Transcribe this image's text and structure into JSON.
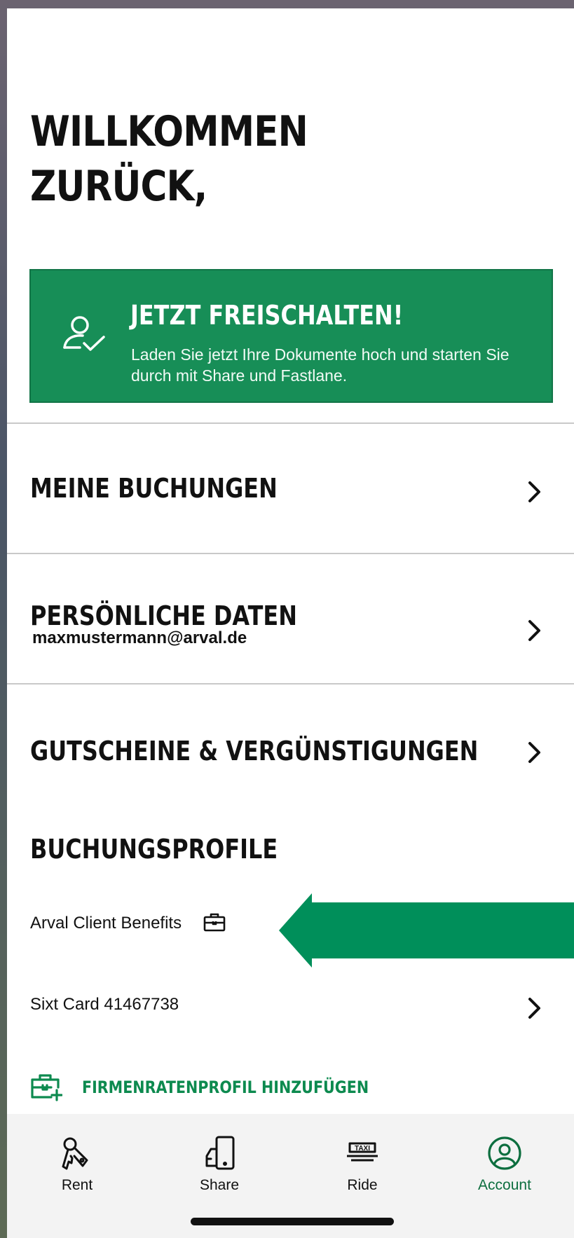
{
  "header": {
    "title_line1": "WILLKOMMEN",
    "title_line2": "ZURÜCK,"
  },
  "promo": {
    "icon": "user-check-icon",
    "title": "JETZT FREISCHALTEN!",
    "text": "Laden Sie jetzt Ihre Dokumente hoch und starten Sie durch mit Share und Fastlane."
  },
  "menu": {
    "bookings": "MEINE BUCHUNGEN",
    "personal": "PERSÖNLICHE DATEN",
    "email": "maxmustermann@arval.de",
    "vouchers": "GUTSCHEINE & VERGÜNSTIGUNGEN"
  },
  "profiles": {
    "heading": "BUCHUNGSPROFILE",
    "items": [
      {
        "label": "Arval Client Benefits",
        "icon": "briefcase-icon"
      },
      {
        "label": "Sixt Card 41467738"
      }
    ],
    "add_label": "FIRMENRATENPROFIL HINZUFÜGEN"
  },
  "tabs": [
    {
      "label": "Rent",
      "icon": "keys-icon"
    },
    {
      "label": "Share",
      "icon": "phone-car-icon"
    },
    {
      "label": "Ride",
      "icon": "taxi-icon"
    },
    {
      "label": "Account",
      "icon": "account-icon",
      "active": true
    }
  ],
  "colors": {
    "accent": "#178e57",
    "arrow": "#008f5a",
    "active_tab": "#0d6e3f"
  }
}
